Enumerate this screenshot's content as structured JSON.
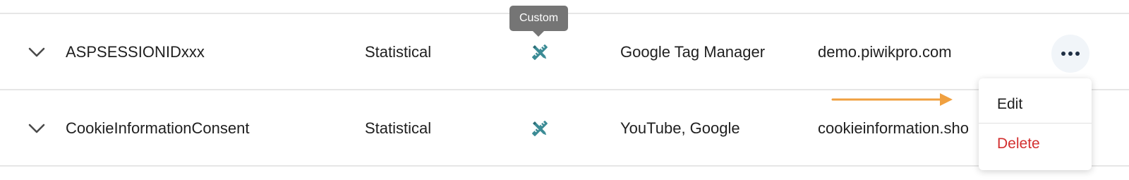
{
  "rows": [
    {
      "name": "ASPSESSIONIDxxx",
      "category": "Statistical",
      "type_icon": "tools-icon",
      "provider": "Google Tag Manager",
      "domain": "demo.piwikpro.com"
    },
    {
      "name": "CookieInformationConsent",
      "category": "Statistical",
      "type_icon": "tools-icon",
      "provider": "YouTube, Google",
      "domain": "cookieinformation.sho"
    }
  ],
  "tooltip": {
    "text": "Custom"
  },
  "actions_menu": {
    "edit_label": "Edit",
    "delete_label": "Delete"
  },
  "colors": {
    "icon_teal": "#3b8b95",
    "delete_red": "#d32f2f",
    "annotation_orange": "#f0a040",
    "kebab_bg": "#f1f5f9"
  }
}
